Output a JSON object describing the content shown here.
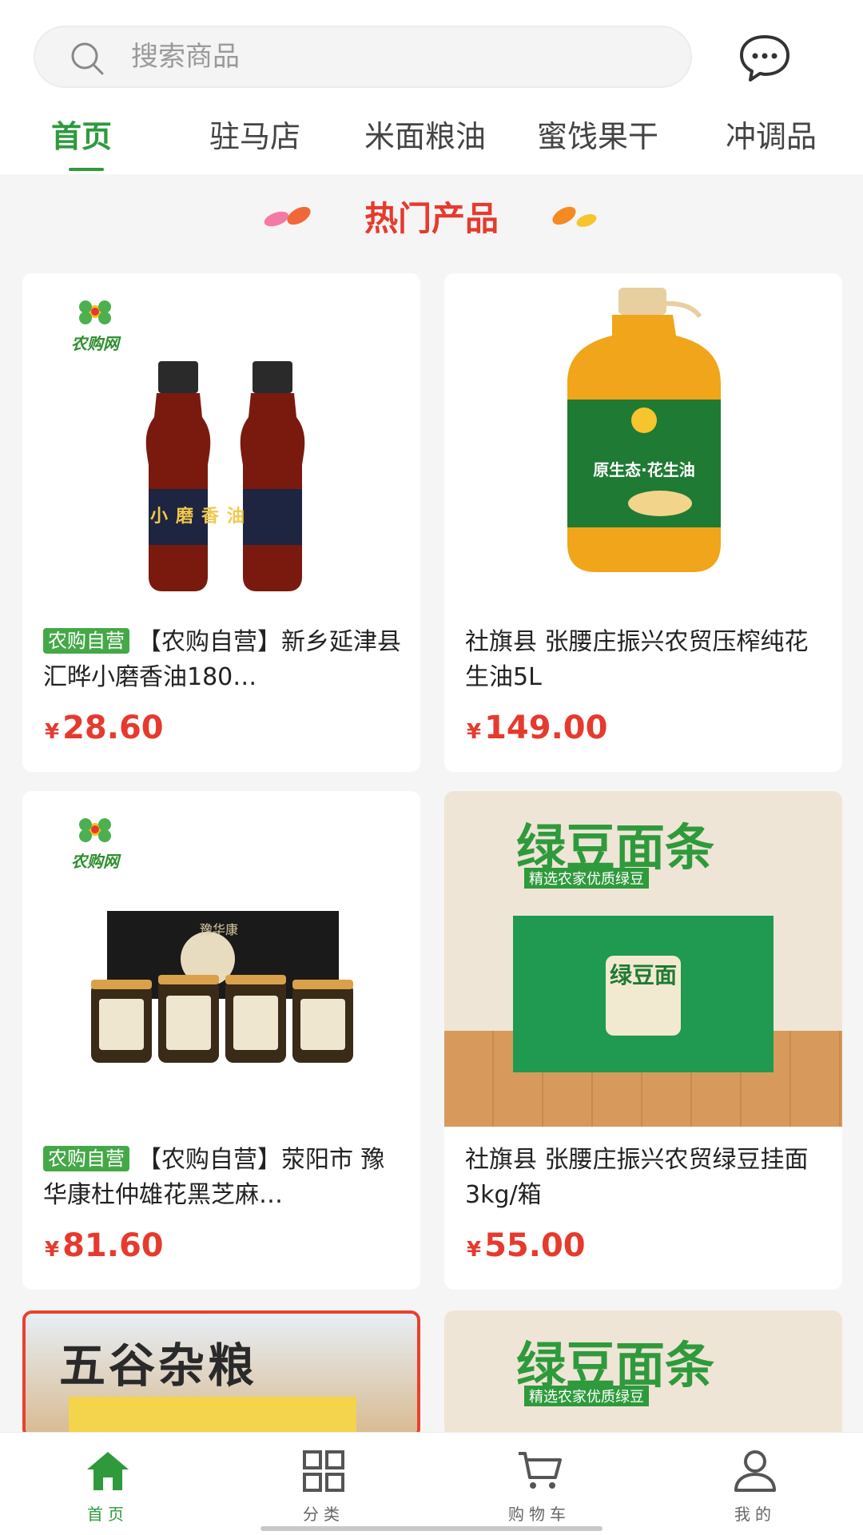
{
  "search": {
    "placeholder": "搜索商品"
  },
  "tabs": [
    {
      "label": "首页",
      "active": true
    },
    {
      "label": "驻马店"
    },
    {
      "label": "米面粮油"
    },
    {
      "label": "蜜饯果干"
    },
    {
      "label": "冲调品"
    }
  ],
  "section": {
    "title": "热门产品"
  },
  "products": [
    {
      "badge": "农购自营",
      "name": "【农购自营】新乡延津县汇晔小磨香油180…",
      "currency": "¥",
      "price": "28.60",
      "logo_text": "农购网",
      "label_text": "小磨香油"
    },
    {
      "name": "社旗县 张腰庄振兴农贸压榨纯花生油5L",
      "currency": "¥",
      "price": "149.00",
      "label_text": "原生态·花生油"
    },
    {
      "badge": "农购自营",
      "name": "【农购自营】荥阳市 豫华康杜仲雄花黑芝麻…",
      "currency": "¥",
      "price": "81.60",
      "logo_text": "农购网",
      "box_text": "豫华康"
    },
    {
      "name": "社旗县 张腰庄振兴农贸绿豆挂面3kg/箱",
      "currency": "¥",
      "price": "55.00",
      "title_text": "绿豆面条",
      "sub_text": "精选农家优质绿豆",
      "box_text": "绿豆面"
    },
    {
      "title_text": "五谷杂粮"
    },
    {
      "title_text": "绿豆面条",
      "sub_text": "精选农家优质绿豆"
    }
  ],
  "bottom_nav": [
    {
      "label": "首页",
      "icon": "home-icon",
      "active": true
    },
    {
      "label": "分类",
      "icon": "grid-icon"
    },
    {
      "label": "购物车",
      "icon": "cart-icon"
    },
    {
      "label": "我的",
      "icon": "user-icon"
    }
  ],
  "colors": {
    "accent": "#2e9a3c",
    "price": "#e63a2e",
    "badge": "#45a847"
  }
}
